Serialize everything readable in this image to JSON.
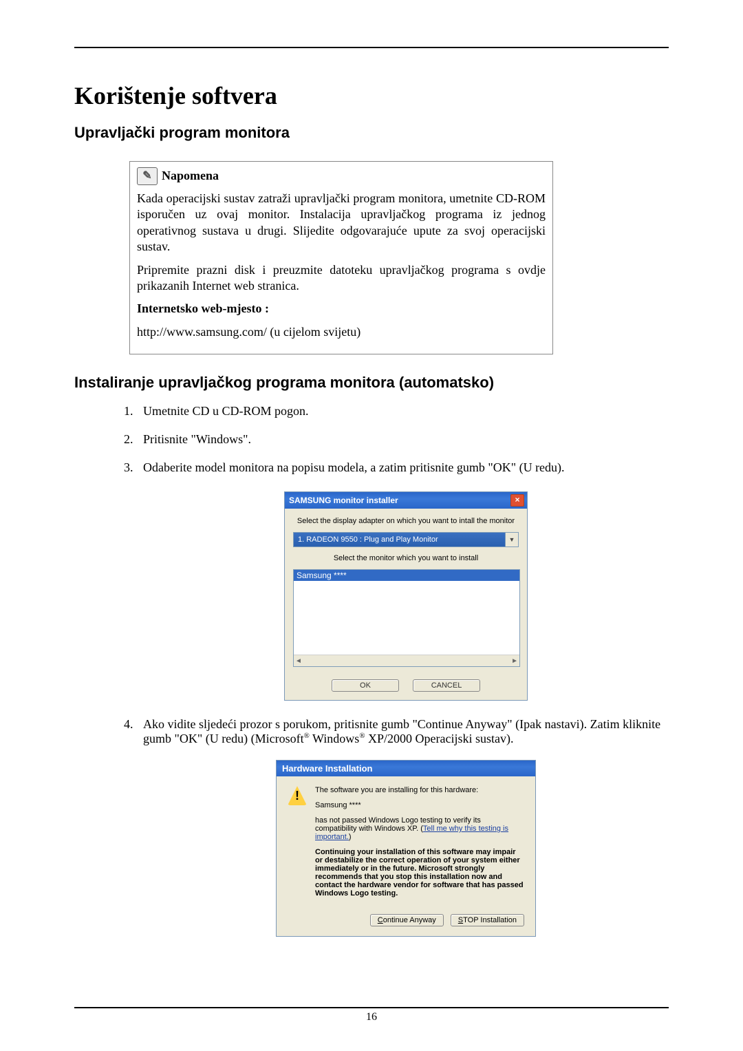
{
  "title": "Korištenje softvera",
  "section1": "Upravljački program monitora",
  "note": {
    "header": "Napomena",
    "p1": "Kada operacijski sustav zatraži upravljački program monitora, umetnite CD-ROM isporučen uz ovaj monitor. Instalacija upravljačkog programa iz jednog operativnog sustava u drugi. Slijedite odgovarajuće upute za svoj operacijski sustav.",
    "p2": "Pripremite prazni disk i preuzmite datoteku upravljačkog programa s ovdje prikazanih Internet web stranica.",
    "label": "Internetsko web-mjesto :",
    "url": "http://www.samsung.com/ (u cijelom svijetu)"
  },
  "section2": "Instaliranje upravljačkog programa monitora (automatsko)",
  "steps": {
    "s1": "Umetnite CD u CD-ROM pogon.",
    "s2": "Pritisnite \"Windows\".",
    "s3": "Odaberite model monitora na popisu modela, a zatim pritisnite gumb \"OK\" (U redu).",
    "s4a": "Ako vidite sljedeći prozor s porukom, pritisnite gumb \"Continue Anyway\" (Ipak nastavi). Zatim kliknite gumb \"OK\" (U redu) (Microsoft",
    "s4b": " Windows",
    "s4c": " XP/2000 Operacijski sustav)."
  },
  "installer": {
    "title": "SAMSUNG monitor installer",
    "line1": "Select the display adapter on which you want to intall the monitor",
    "combo": "1. RADEON 9550 : Plug and Play Monitor",
    "line2": "Select the monitor which you want to install",
    "list_item": "Samsung ****",
    "ok": "OK",
    "cancel": "CANCEL"
  },
  "hw": {
    "title": "Hardware Installation",
    "p1": "The software you are installing for this hardware:",
    "device": "Samsung ****",
    "p2a": "has not passed Windows Logo testing to verify its compatibility with Windows XP. (",
    "link": "Tell me why this testing is important.",
    "p2b": ")",
    "p3": "Continuing your installation of this software may impair or destabilize the correct operation of your system either immediately or in the future. Microsoft strongly recommends that you stop this installation now and contact the hardware vendor for software that has passed Windows Logo testing.",
    "btn_continue_u": "C",
    "btn_continue_rest": "ontinue Anyway",
    "btn_stop_u": "S",
    "btn_stop_rest": "TOP Installation"
  },
  "page_number": "16"
}
